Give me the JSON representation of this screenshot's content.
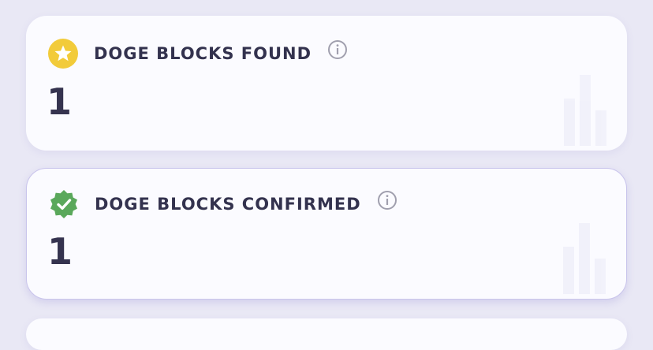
{
  "stats": [
    {
      "title": "DOGE BLOCKS FOUND",
      "value": "1",
      "icon": "star-badge-icon",
      "icon_color": "#f2cb3a"
    },
    {
      "title": "DOGE BLOCKS CONFIRMED",
      "value": "1",
      "icon": "verified-check-badge-icon",
      "icon_color": "#5aa85b"
    }
  ],
  "colors": {
    "background": "#e9e8f5",
    "card": "#fbfbff",
    "text": "#33324e",
    "info_icon": "#a09fae"
  }
}
